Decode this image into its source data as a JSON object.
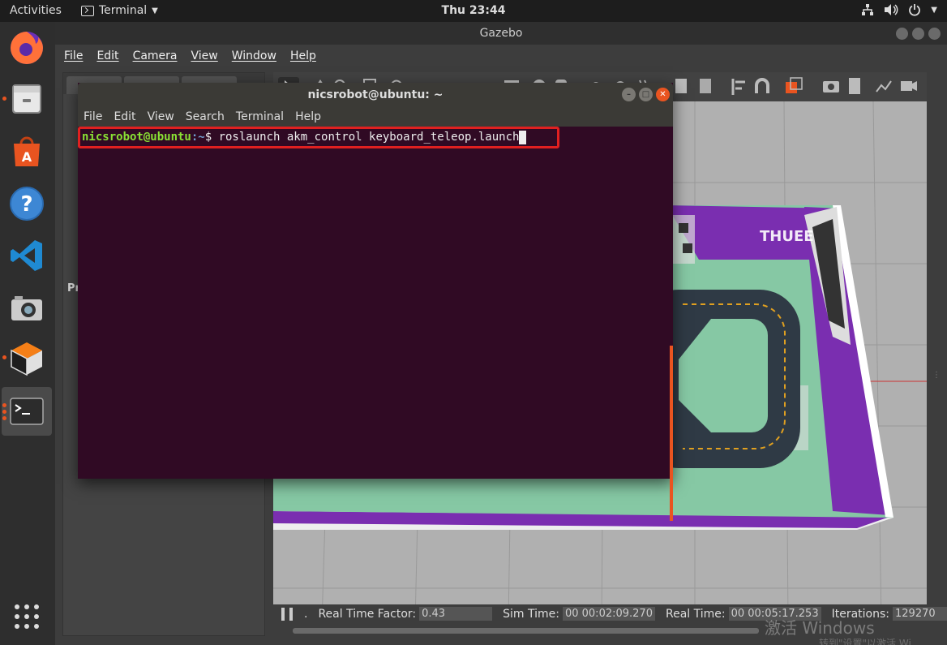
{
  "topbar": {
    "activities": "Activities",
    "app_name": "Terminal",
    "clock": "Thu 23:44"
  },
  "dock": {
    "items": [
      "firefox-icon",
      "files-icon",
      "software-center-icon",
      "help-icon",
      "vscode-icon",
      "camera-icon",
      "virtualbox-icon",
      "terminal-icon",
      "show-apps-icon"
    ]
  },
  "gazebo": {
    "title": "Gazebo",
    "menu": [
      "File",
      "Edit",
      "Camera",
      "View",
      "Window",
      "Help"
    ],
    "left_panel_label": "Pr",
    "status": {
      "dot": ".",
      "real_time_factor_label": "Real Time Factor:",
      "real_time_factor": "0.43",
      "sim_time_label": "Sim Time:",
      "sim_time": "00 00:02:09.270",
      "real_time_label": "Real Time:",
      "real_time": "00 00:05:17.253",
      "iterations_label": "Iterations:",
      "iterations": "129270"
    },
    "track_brand": "THUEE",
    "watermark": "激活 Windows",
    "watermark_sub": "转到\"设置\"以激活 Wi"
  },
  "terminal": {
    "title": "nicsrobot@ubuntu: ~",
    "menu": [
      "File",
      "Edit",
      "View",
      "Search",
      "Terminal",
      "Help"
    ],
    "prompt_user": "nicsrobot@ubuntu",
    "prompt_path": ":~",
    "prompt_symbol": "$ ",
    "command": "roslaunch akm_control keyboard_teleop.launch"
  },
  "colors": {
    "terminal_bg": "#300a24",
    "prompt_user": "#8ae234",
    "prompt_path": "#729fcf",
    "highlight": "#e02020",
    "ubuntu_orange": "#e95420"
  }
}
